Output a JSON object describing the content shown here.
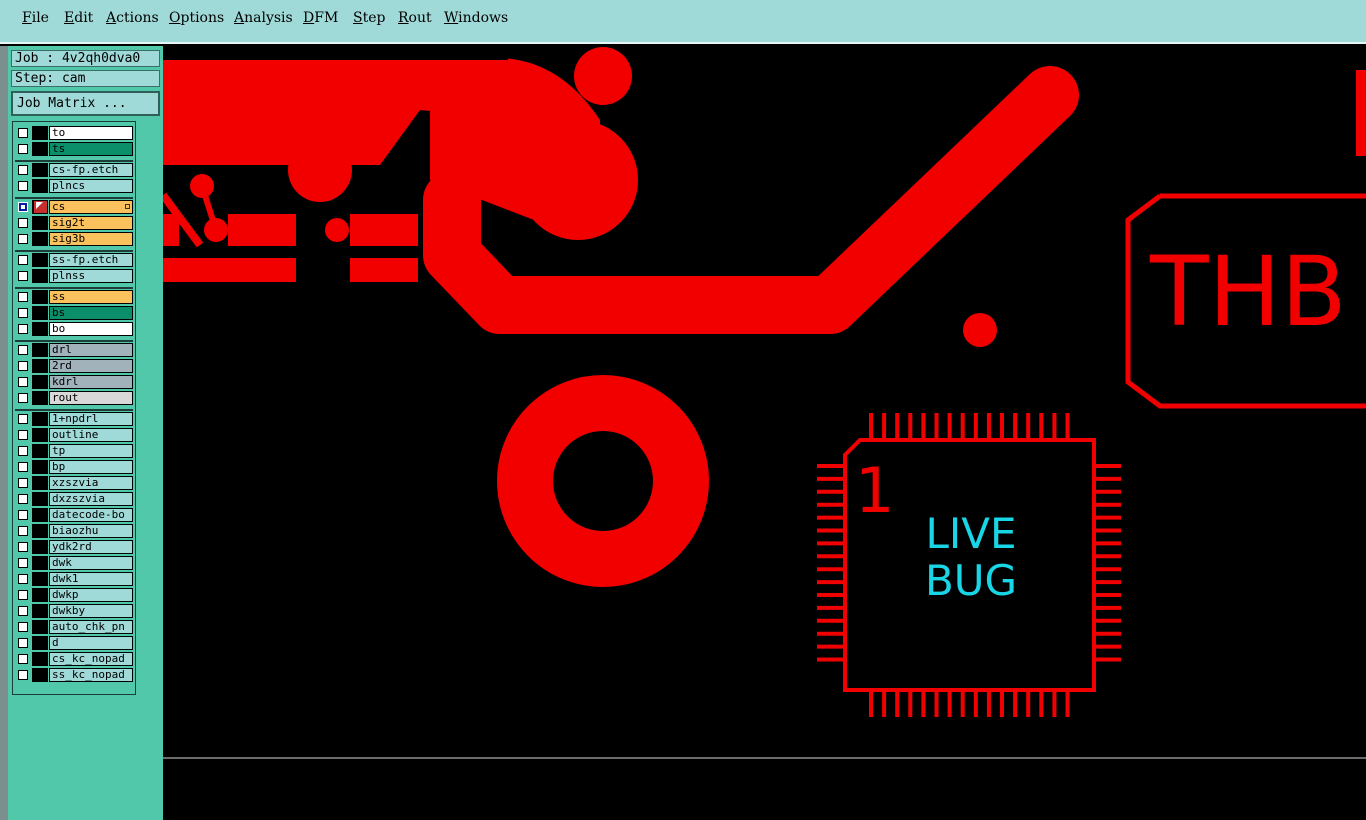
{
  "menu": [
    "File",
    "Edit",
    "Actions",
    "Options",
    "Analysis",
    "DFM",
    "Step",
    "Rout",
    "Windows"
  ],
  "job": {
    "label": "Job : 4v2qh0dva0",
    "step": "Step: cam",
    "matrix_button": "Job Matrix ..."
  },
  "colors": {
    "menubar": "#9fd9d8",
    "panel": "#52c8aa",
    "copper": "#f20000",
    "silkscreen_text": "#18d6e6",
    "white_layer": "#ffffff",
    "green_layer": "#0a8f6a",
    "orange_layer": "#fbc15d",
    "gray_layer": "#a2b2ba",
    "light_gray_layer": "#d8d8d8",
    "cyan_layer": "#9fd9d8"
  },
  "layers": [
    {
      "name": "to",
      "color": "#ffffff",
      "group": 1
    },
    {
      "name": "ts",
      "color": "#0a8f6a",
      "group": 1
    },
    {
      "name": "cs-fp.etch",
      "color": "#9fd9d8",
      "group": 2
    },
    {
      "name": "plncs",
      "color": "#9fd9d8",
      "group": 2
    },
    {
      "name": "cs",
      "color": "#fbc15d",
      "group": 3,
      "active": true
    },
    {
      "name": "sig2t",
      "color": "#fbc15d",
      "group": 3
    },
    {
      "name": "sig3b",
      "color": "#fbc15d",
      "group": 3
    },
    {
      "name": "ss-fp.etch",
      "color": "#9fd9d8",
      "group": 4
    },
    {
      "name": "plnss",
      "color": "#9fd9d8",
      "group": 4
    },
    {
      "name": "ss",
      "color": "#fbc15d",
      "group": 5
    },
    {
      "name": "bs",
      "color": "#0a8f6a",
      "group": 5
    },
    {
      "name": "bo",
      "color": "#ffffff",
      "group": 5
    },
    {
      "name": "drl",
      "color": "#a2b2ba",
      "group": 6
    },
    {
      "name": "2rd",
      "color": "#a2b2ba",
      "group": 6
    },
    {
      "name": "kdrl",
      "color": "#a2b2ba",
      "group": 6
    },
    {
      "name": "rout",
      "color": "#d8d8d8",
      "group": 6
    },
    {
      "name": "1+npdrl",
      "color": "#9fd9d8",
      "group": 7
    },
    {
      "name": "outline",
      "color": "#9fd9d8",
      "group": 7
    },
    {
      "name": "tp",
      "color": "#9fd9d8",
      "group": 7
    },
    {
      "name": "bp",
      "color": "#9fd9d8",
      "group": 7
    },
    {
      "name": "xzszvia",
      "color": "#9fd9d8",
      "group": 7
    },
    {
      "name": "dxzszvia",
      "color": "#9fd9d8",
      "group": 7
    },
    {
      "name": "datecode-bo",
      "color": "#9fd9d8",
      "group": 7
    },
    {
      "name": "biaozhu",
      "color": "#9fd9d8",
      "group": 7
    },
    {
      "name": "ydk2rd",
      "color": "#9fd9d8",
      "group": 7
    },
    {
      "name": "dwk",
      "color": "#9fd9d8",
      "group": 7
    },
    {
      "name": "dwk1",
      "color": "#9fd9d8",
      "group": 7
    },
    {
      "name": "dwkp",
      "color": "#9fd9d8",
      "group": 7
    },
    {
      "name": "dwkby",
      "color": "#9fd9d8",
      "group": 7
    },
    {
      "name": "auto_chk_pn",
      "color": "#9fd9d8",
      "group": 7
    },
    {
      "name": "d",
      "color": "#9fd9d8",
      "group": 7
    },
    {
      "name": "cs_kc_nopad",
      "color": "#9fd9d8",
      "group": 7
    },
    {
      "name": "ss_kc_nopad",
      "color": "#9fd9d8",
      "group": 7
    }
  ],
  "canvas": {
    "pin1_label": "1",
    "part_label_line1": "LIVE",
    "part_label_line2": "BUG",
    "board_text": "THB"
  }
}
